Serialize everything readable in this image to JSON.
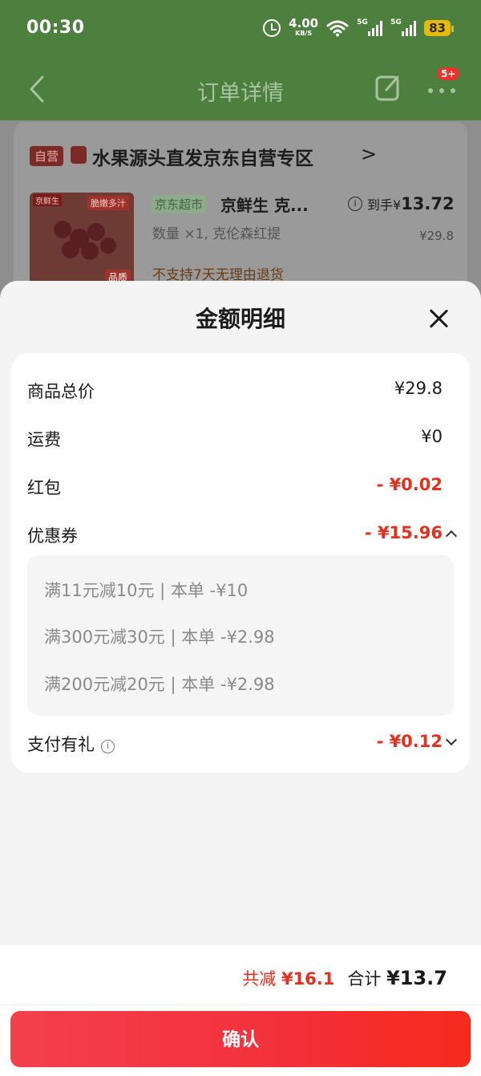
{
  "status_bar": {
    "time": "00:30",
    "speed_value": "4.00",
    "speed_unit": "KB/S",
    "signal1_label": "5G",
    "signal2_label": "5G",
    "battery": "83"
  },
  "nav": {
    "title": "订单详情",
    "more_badge": "5+"
  },
  "order": {
    "self_tag": "自营",
    "shop_name": "水果源头直发京东自营专区",
    "shop_arrow": ">",
    "image_tags": [
      "京鲜生",
      "脆嫩多汁",
      "品质"
    ],
    "store_tag": "京东超市",
    "product_name": "京鲜生 克...",
    "price_prefix": "到手¥",
    "price_final": "13.72",
    "price_original": "¥29.8",
    "quantity": "数量 ×1, 克伦森红提",
    "return_policy": "不支持7天无理由退货"
  },
  "sheet": {
    "title": "金额明细",
    "rows": [
      {
        "label": "商品总价",
        "value": "¥29.8"
      },
      {
        "label": "运费",
        "value": "¥0"
      },
      {
        "label": "红包",
        "value": "- ¥0.02"
      },
      {
        "label": "优惠券",
        "value": "- ¥15.96"
      },
      {
        "label": "支付有礼",
        "value": "- ¥0.12"
      }
    ],
    "coupons": [
      "满11元减10元 | 本单 -¥10",
      "满300元减30元 | 本单 -¥2.98",
      "满200元减20元 | 本单 -¥2.98"
    ]
  },
  "footer": {
    "saved_label": "共减",
    "saved_value": "¥16.1",
    "total_label": "合计",
    "total_currency": "¥",
    "total_value": "13.7",
    "confirm_label": "确认"
  },
  "colors": {
    "nav_green": "#4d7f3e",
    "accent_red": "#e6301f",
    "button_red": "#f3303a",
    "battery_yellow": "#e7b900"
  }
}
